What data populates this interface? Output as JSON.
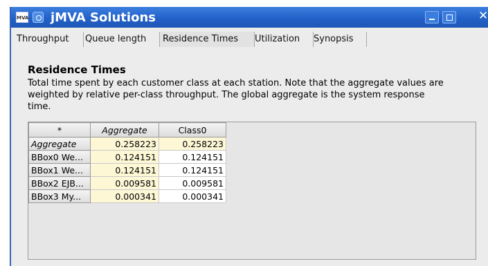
{
  "window": {
    "title": "jMVA Solutions",
    "app_icon_text": "MVA",
    "close_glyph": "✕"
  },
  "tabs": [
    {
      "label": "Throughput",
      "active": false
    },
    {
      "label": "Queue length",
      "active": false
    },
    {
      "label": "Residence Times",
      "active": true
    },
    {
      "label": "Utilization",
      "active": false
    },
    {
      "label": "Synopsis",
      "active": false
    }
  ],
  "content": {
    "title": "Residence Times",
    "description": "Total time spent by each customer class at each station. Note that the aggregate values are weighted by relative per-class throughput. The global aggregate is the system response time."
  },
  "table": {
    "headers": [
      "*",
      "Aggregate",
      "Class0"
    ],
    "rows": [
      {
        "label": "Aggregate",
        "aggregate": "0.258223",
        "class0": "0.258223"
      },
      {
        "label": "BBox0 We...",
        "aggregate": "0.124151",
        "class0": "0.124151"
      },
      {
        "label": "BBox1  We...",
        "aggregate": "0.124151",
        "class0": "0.124151"
      },
      {
        "label": "BBox2  EJB...",
        "aggregate": "0.009581",
        "class0": "0.009581"
      },
      {
        "label": "BBox3  My...",
        "aggregate": "0.000341",
        "class0": "0.000341"
      }
    ]
  },
  "colors": {
    "titlebar": "#2361c8",
    "highlight_cell": "#fdf7d6"
  }
}
